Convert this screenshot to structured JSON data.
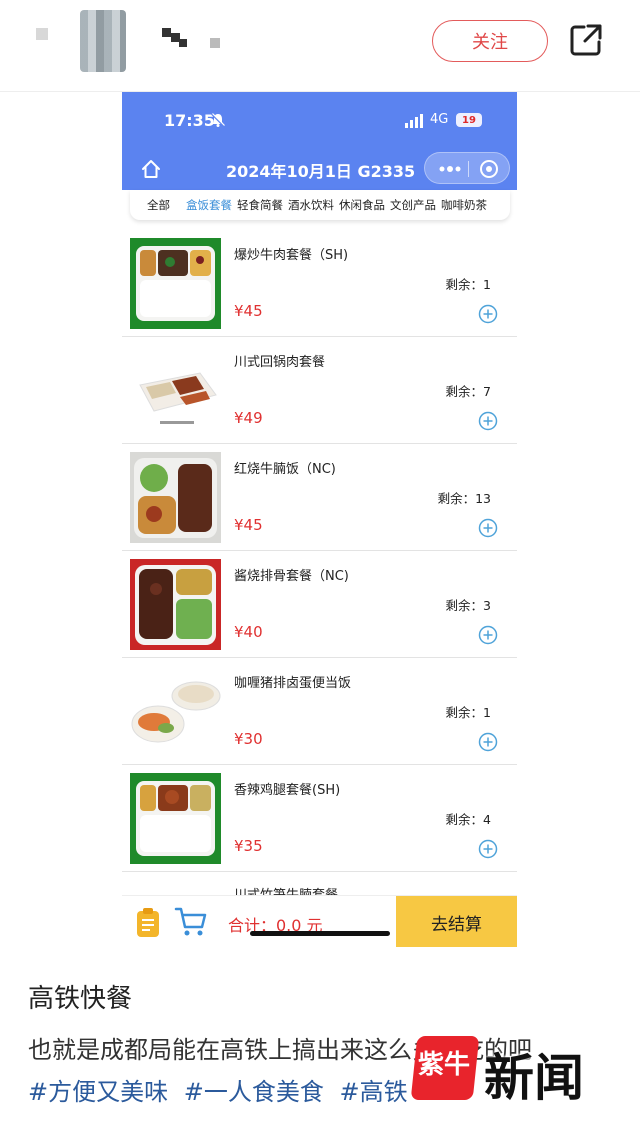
{
  "post_header": {
    "follow_label": "关注"
  },
  "phone": {
    "status_time": "17:35",
    "network": "4G",
    "battery": "19",
    "title": "2024年10月1日 G2335",
    "categories": [
      "全部",
      "盒饭套餐",
      "轻食简餐",
      "酒水饮料",
      "休闲食品",
      "文创产品",
      "咖啡奶茶"
    ],
    "active_category": "盒饭套餐",
    "items": [
      {
        "name": "爆炒牛肉套餐（SH)",
        "price": "¥45",
        "stock": "剩余：1"
      },
      {
        "name": "川式回锅肉套餐",
        "price": "¥49",
        "stock": "剩余：7"
      },
      {
        "name": "红烧牛腩饭（NC)",
        "price": "¥45",
        "stock": "剩余：13"
      },
      {
        "name": "酱烧排骨套餐（NC)",
        "price": "¥40",
        "stock": "剩余：3"
      },
      {
        "name": "咖喱猪排卤蛋便当饭",
        "price": "¥30",
        "stock": "剩余：1"
      },
      {
        "name": "香辣鸡腿套餐(SH)",
        "price": "¥35",
        "stock": "剩余：4"
      },
      {
        "name": "川式竹笋牛腩套餐"
      }
    ],
    "cart_total": "合计：0.0 元",
    "checkout_label": "去结算"
  },
  "post": {
    "title": "高铁快餐",
    "body": "也就是成都局能在高铁上搞出来这么多好吃的吧",
    "tags": [
      "#方便又美味",
      "#一人食美食",
      "#高铁"
    ]
  },
  "watermark": {
    "badge": "紫牛",
    "text": "新闻"
  },
  "colors": {
    "header_blue": "#5b83f0",
    "price_red": "#e03131",
    "active_tab": "#3a8ed8",
    "checkout_yellow": "#f7c843",
    "follow_red": "#e04848",
    "tag_blue": "#2b5a9c"
  }
}
